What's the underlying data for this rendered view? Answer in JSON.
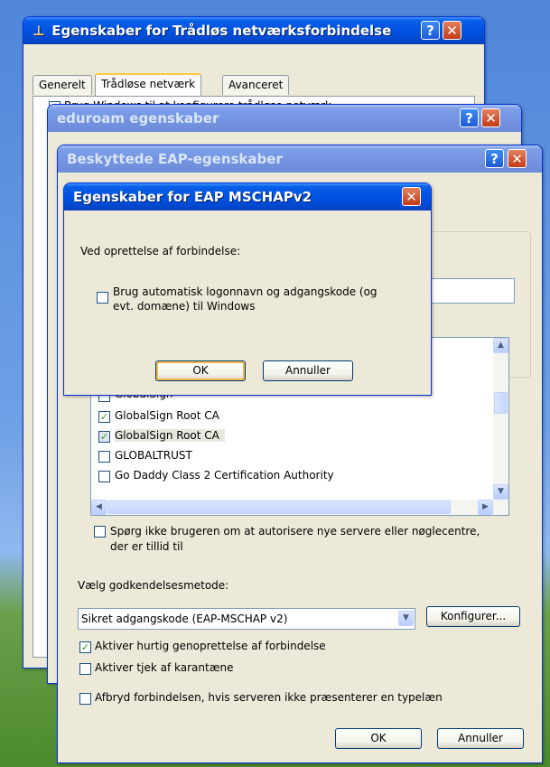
{
  "win1": {
    "title": "Egenskaber for Trådløs netværksforbindelse",
    "tabs": [
      "Generelt",
      "Trådløse netværk",
      "Avanceret"
    ],
    "partial_text": "Brug Windows til at konfigurere trådløse netværk"
  },
  "win2": {
    "title": "eduroam egenskaber"
  },
  "win3": {
    "title": "Beskyttede EAP-egenskaber",
    "cert_list": [
      {
        "name": "GlobalSign",
        "checked": false
      },
      {
        "name": "GlobalSign Root CA",
        "checked": true
      },
      {
        "name": "GlobalSign Root CA",
        "checked": true,
        "selected": true
      },
      {
        "name": "GLOBALTRUST",
        "checked": false
      },
      {
        "name": "Go Daddy Class 2 Certification Authority",
        "checked": false
      }
    ],
    "prompt_checkbox": "Spørg ikke brugeren om at autorisere nye servere eller nøglecentre, der er tillid til",
    "method_label": "Vælg godkendelsesmetode:",
    "method_value": "Sikret adgangskode (EAP-MSCHAP v2)",
    "configure_button": "Konfigurer...",
    "options": [
      {
        "label": "Aktiver hurtig genoprettelse af forbindelse",
        "checked": true
      },
      {
        "label": "Aktiver tjek af karantæne",
        "checked": false
      },
      {
        "label": "Afbryd forbindelsen, hvis serveren ikke præsenterer en typelæn",
        "checked": false
      }
    ],
    "ok": "OK",
    "cancel": "Annuller"
  },
  "dialog": {
    "title": "Egenskaber for EAP MSCHAPv2",
    "heading": "Ved oprettelse af forbindelse:",
    "checkbox_line1": "Brug automatisk logonnavn og adgangskode (og",
    "checkbox_line2": "evt. domæne) til Windows",
    "checkbox_checked": false,
    "ok": "OK",
    "cancel": "Annuller"
  },
  "colors": {
    "title_active": "#0054e3",
    "window_face": "#ece9d8",
    "accent_focus": "#f0b948"
  }
}
